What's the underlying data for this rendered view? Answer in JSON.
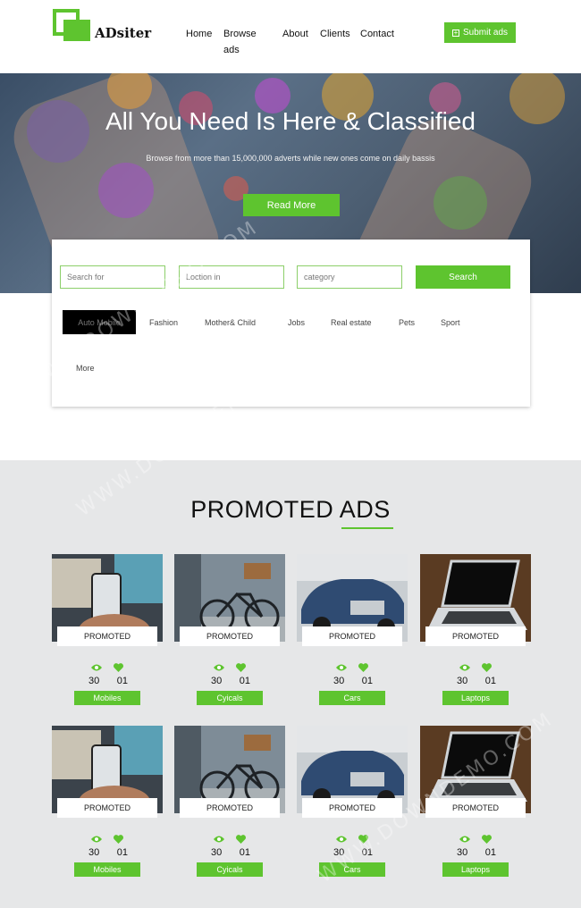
{
  "header": {
    "logo_text": "ADsiter",
    "nav": [
      {
        "label": "Home"
      },
      {
        "label": "Browse",
        "label2": "ads"
      },
      {
        "label": "About"
      },
      {
        "label": "Clients"
      },
      {
        "label": "Contact"
      }
    ],
    "submit_label": "Submit ads"
  },
  "hero": {
    "title": "All You Need Is Here & Classified",
    "subtitle": "Browse from more than 15,000,000 adverts while new ones come on daily bassis",
    "read_more": "Read More"
  },
  "search": {
    "search_for_placeholder": "Search for",
    "location_placeholder": "Loction in",
    "category_placeholder": "category",
    "button": "Search",
    "categories": [
      "Auto Mobile",
      "Fashion",
      "Mother& Child",
      "Jobs",
      "Real estate",
      "Pets",
      "Sport",
      "More"
    ]
  },
  "promoted": {
    "title": "PROMOTED ADS",
    "badge": "PROMOTED",
    "cards": [
      {
        "image": "mobile-photo",
        "views": "30",
        "likes": "01",
        "tag": "Mobiles"
      },
      {
        "image": "bicycle-photo",
        "views": "30",
        "likes": "01",
        "tag": "Cyicals"
      },
      {
        "image": "car-photo",
        "views": "30",
        "likes": "01",
        "tag": "Cars"
      },
      {
        "image": "laptop-photo",
        "views": "30",
        "likes": "01",
        "tag": "Laptops"
      },
      {
        "image": "mobile-photo",
        "views": "30",
        "likes": "01",
        "tag": "Mobiles"
      },
      {
        "image": "bicycle-photo",
        "views": "30",
        "likes": "01",
        "tag": "Cyicals"
      },
      {
        "image": "car-photo",
        "views": "30",
        "likes": "01",
        "tag": "Cars"
      },
      {
        "image": "laptop-photo",
        "views": "30",
        "likes": "01",
        "tag": "Laptops"
      }
    ]
  },
  "colors": {
    "accent": "#5ec42f",
    "section_bg": "#e6e7e8"
  }
}
